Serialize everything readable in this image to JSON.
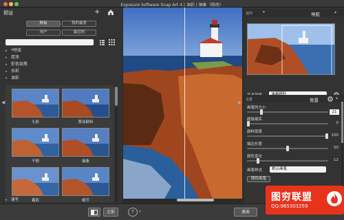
{
  "window": {
    "title": "Exposure Software Snap Art 4 | 油彩 | 抽象（修改）"
  },
  "left_panel": {
    "title": "预设",
    "tabs": [
      {
        "label": "所有",
        "active": true
      },
      {
        "label": "我的最爱",
        "active": false
      },
      {
        "label": "用户",
        "active": false
      },
      {
        "label": "最近的",
        "active": false
      }
    ],
    "search": {
      "placeholder": ""
    },
    "tree": [
      {
        "label": "*特效",
        "expanded": false
      },
      {
        "label": "厚涂",
        "expanded": false
      },
      {
        "label": "彩色铅笔",
        "expanded": false
      },
      {
        "label": "水彩",
        "expanded": false
      },
      {
        "label": "油彩",
        "expanded": true
      }
    ],
    "thumbnails": [
      {
        "label": "七彩"
      },
      {
        "label": "厚涂颜料"
      },
      {
        "label": "干刷"
      },
      {
        "label": "抽象"
      },
      {
        "label": "着彩"
      },
      {
        "label": "细节"
      }
    ],
    "bottom_item": "速写"
  },
  "right_panel": {
    "nav_title": "导航",
    "nav_tag": "迷你",
    "style_label": "艺术风格",
    "style_value": "油画颜料",
    "bg_title": "背景",
    "bg_tag": "设置",
    "params": [
      {
        "label": "画笔的大小",
        "value": "21",
        "boxed": true,
        "level": 0.17
      },
      {
        "label": "超级细实",
        "value": "0",
        "boxed": false,
        "level": 0.0
      },
      {
        "label": "颜料厚度",
        "value": "100",
        "boxed": false,
        "level": 1.0
      },
      {
        "label": "描边长度",
        "value": "50",
        "boxed": false,
        "level": 0.5
      },
      {
        "label": "颜色变化",
        "value": "12",
        "boxed": false,
        "level": 0.12
      }
    ],
    "brush_style_label": "画笔样式",
    "brush_style_value": "默认画笔",
    "random_button": "随机画笔"
  },
  "bottom_bar": {
    "sidebar_toggle_label": "之前",
    "help_label": "?",
    "exit_label": "退出",
    "apply_label": "确定"
  },
  "watermark": {
    "title": "图穷联盟",
    "qq": "QQ:985303259"
  },
  "colors": {
    "accent_red": "#e8331c",
    "panel_bg": "#333333"
  }
}
